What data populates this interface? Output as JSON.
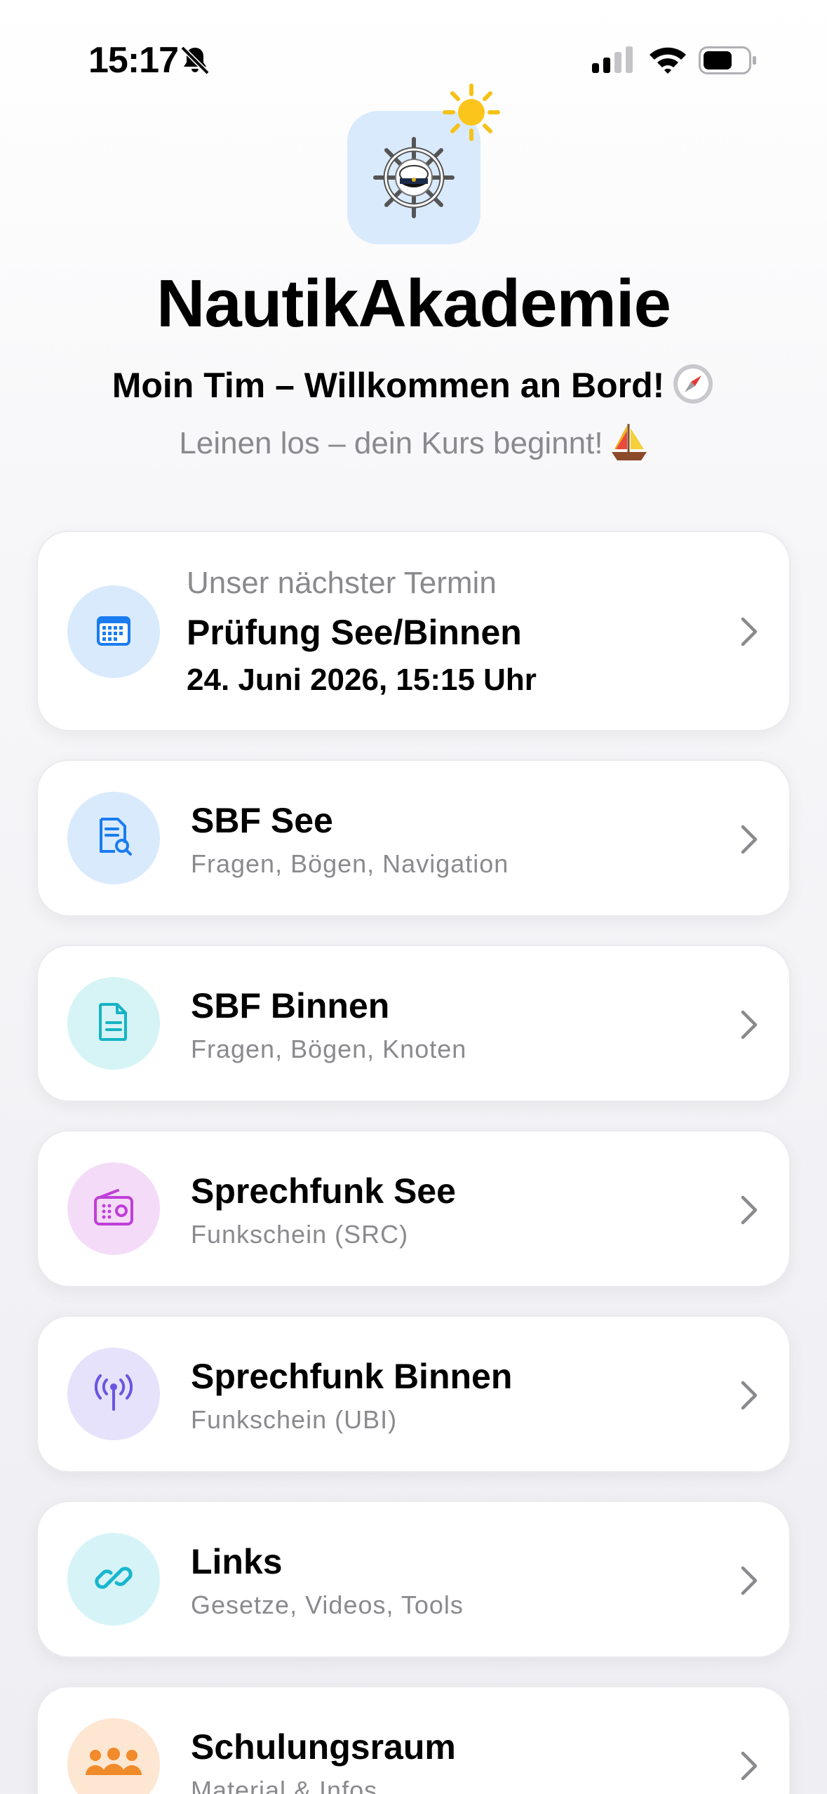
{
  "status_bar": {
    "time": "15:17",
    "icons": [
      "bell-slash-icon",
      "cellular-signal-icon",
      "wifi-icon",
      "battery-icon"
    ]
  },
  "header": {
    "app_icon": "ship-wheel-captain-hat-icon",
    "weather_icon": "sun-icon",
    "title": "NautikAkademie",
    "welcome": "Moin Tim – Willkommen an Bord!",
    "welcome_emoji": "🧭",
    "tagline": "Leinen los – dein Kurs beginnt!",
    "tagline_emoji": "⛵"
  },
  "appointment": {
    "label": "Unser nächster Termin",
    "title": "Prüfung See/Binnen",
    "date": "24. Juni 2026, 15:15 Uhr",
    "icon": "calendar-icon"
  },
  "menu": [
    {
      "title": "SBF See",
      "subtitle": "Fragen, Bögen, Navigation",
      "icon": "document-search-icon",
      "color": "#1a7cf0",
      "bg": "#d9eafd"
    },
    {
      "title": "SBF Binnen",
      "subtitle": "Fragen, Bögen, Knoten",
      "icon": "document-icon",
      "color": "#16b3c4",
      "bg": "#d6f4f6"
    },
    {
      "title": "Sprechfunk See",
      "subtitle": "Funkschein (SRC)",
      "icon": "radio-icon",
      "color": "#c03fd8",
      "bg": "#f4dcf8"
    },
    {
      "title": "Sprechfunk Binnen",
      "subtitle": "Funkschein (UBI)",
      "icon": "antenna-icon",
      "color": "#6a55e0",
      "bg": "#e6e2fb"
    },
    {
      "title": "Links",
      "subtitle": "Gesetze, Videos, Tools",
      "icon": "link-icon",
      "color": "#19b6cf",
      "bg": "#d6f4f8"
    },
    {
      "title": "Schulungsraum",
      "subtitle": "Material & Infos",
      "icon": "people-icon",
      "color": "#f08a2a",
      "bg": "#fde6d2"
    }
  ]
}
